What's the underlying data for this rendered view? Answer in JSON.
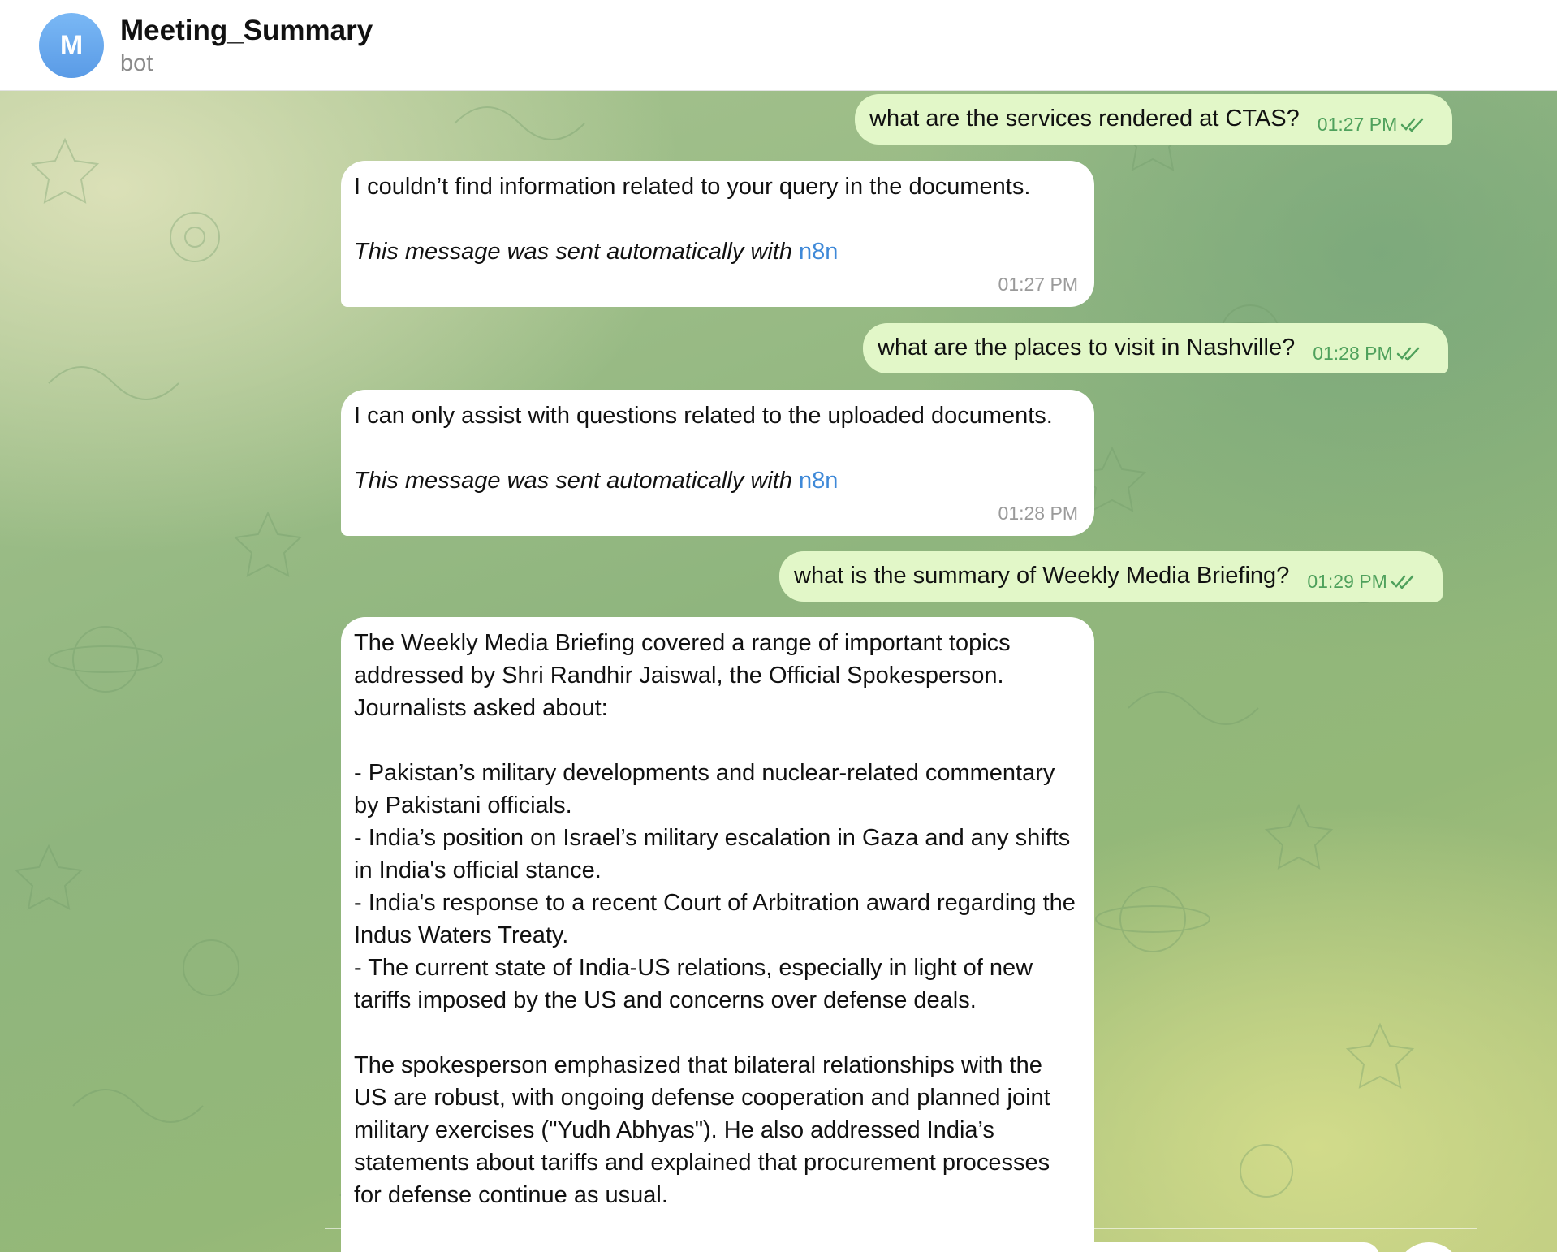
{
  "header": {
    "avatar_letter": "M",
    "title": "Meeting_Summary",
    "subtitle": "bot"
  },
  "messages": [
    {
      "side": "out",
      "text": "what are the services rendered at CTAS?",
      "time": "01:27 PM",
      "status": "read"
    },
    {
      "side": "in",
      "text": "I couldn’t find information related to your query in the documents.",
      "auto_prefix": "This message was sent automatically with ",
      "auto_link": "n8n",
      "time": "01:27 PM"
    },
    {
      "side": "out",
      "text": "what are the places to visit in Nashville?",
      "time": "01:28 PM",
      "status": "read"
    },
    {
      "side": "in",
      "text": "I can only assist with questions related to the uploaded documents.",
      "auto_prefix": "This message was sent automatically with ",
      "auto_link": "n8n",
      "time": "01:28 PM"
    },
    {
      "side": "out",
      "text": "what is the summary of Weekly Media Briefing?",
      "time": "01:29 PM",
      "status": "read"
    },
    {
      "side": "in",
      "intro": "The Weekly Media Briefing covered a range of important topics addressed by Shri Randhir Jaiswal, the Official Spokesperson. Journalists asked about:",
      "bullets": [
        "- Pakistan’s military developments and nuclear-related commentary by Pakistani officials.",
        "- India’s position on Israel’s military escalation in Gaza and any shifts in India's official stance.",
        "- India's response to a recent Court of Arbitration award regarding the Indus Waters Treaty.",
        "- The current state of India-US relations, especially in light of new tariffs imposed by the US and concerns over defense deals."
      ],
      "outro": "The spokesperson emphasized that bilateral relationships with the US are robust, with ongoing defense cooperation and planned joint military exercises (\"Yudh Abhyas\"). He also addressed India’s statements about tariffs and explained that procurement processes for defense continue as usual."
    }
  ],
  "colors": {
    "outgoing_bubble": "#e2f7c8",
    "incoming_bubble": "#ffffff",
    "outgoing_time": "#4fa15c",
    "link": "#3f89d8",
    "avatar": "#6aa9ee"
  }
}
